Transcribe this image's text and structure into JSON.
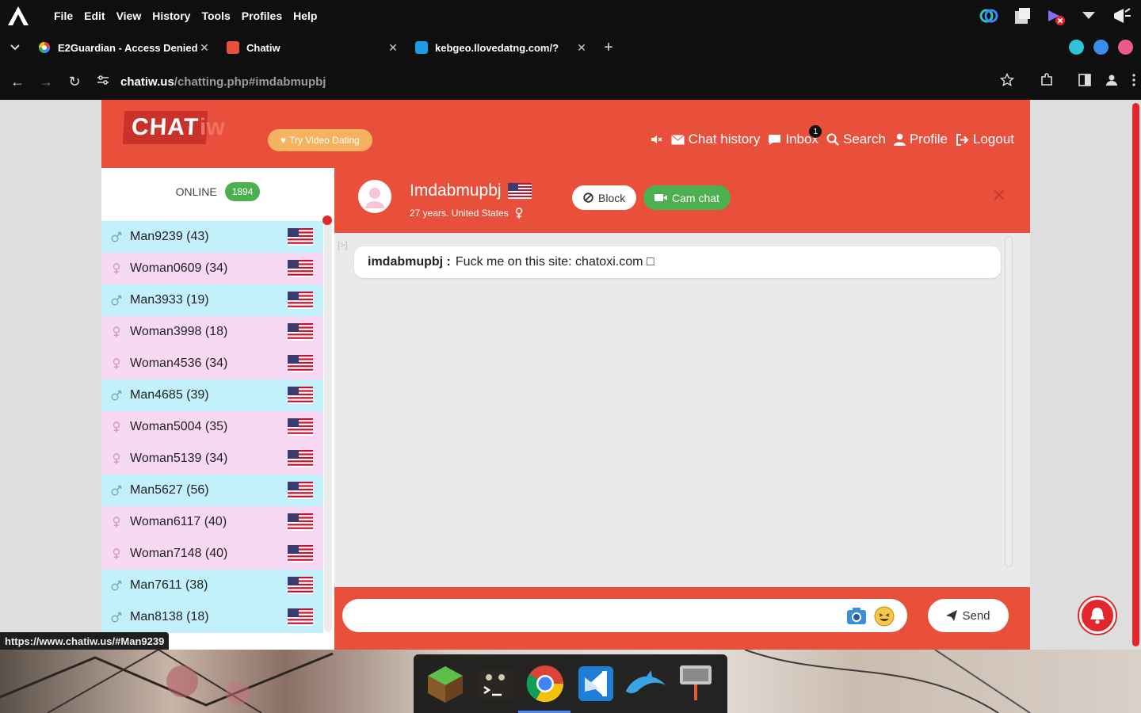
{
  "menubar": {
    "items": [
      "File",
      "Edit",
      "View",
      "History",
      "Tools",
      "Profiles",
      "Help"
    ]
  },
  "tabs": [
    {
      "title": "E2Guardian - Access Denied",
      "favicon": "google-icon"
    },
    {
      "title": "Chatiw",
      "favicon": "chatiw-icon"
    },
    {
      "title": "kebgeo.llovedatng.com/?",
      "favicon": "blue-square-icon"
    }
  ],
  "address": {
    "host": "chatiw.us",
    "path": "/chatting.php#imdabmupbj"
  },
  "site": {
    "brand_chat": "CHAT",
    "brand_iw": "iw",
    "video_button": "Try Video Dating",
    "nav": {
      "chat_history": "Chat history",
      "inbox": "Inbox",
      "inbox_badge": "1",
      "search": "Search",
      "profile": "Profile",
      "logout": "Logout"
    }
  },
  "sidebar": {
    "online_label": "ONLINE",
    "online_count": "1894",
    "users": [
      {
        "name": "Man9239 (43)",
        "gender": "male"
      },
      {
        "name": "Woman0609 (34)",
        "gender": "female"
      },
      {
        "name": "Man3933 (19)",
        "gender": "male"
      },
      {
        "name": "Woman3998 (18)",
        "gender": "female"
      },
      {
        "name": "Woman4536 (34)",
        "gender": "female"
      },
      {
        "name": "Man4685 (39)",
        "gender": "male"
      },
      {
        "name": "Woman5004 (35)",
        "gender": "female"
      },
      {
        "name": "Woman5139 (34)",
        "gender": "female"
      },
      {
        "name": "Man5627 (56)",
        "gender": "male"
      },
      {
        "name": "Woman6117 (40)",
        "gender": "female"
      },
      {
        "name": "Woman7148 (40)",
        "gender": "female"
      },
      {
        "name": "Man7611 (38)",
        "gender": "male"
      },
      {
        "name": "Man8138 (18)",
        "gender": "male"
      }
    ]
  },
  "chat": {
    "partner_name": "Imdabmupbj",
    "partner_info": "27 years. United States",
    "block_label": "Block",
    "cam_label": "Cam chat",
    "close_glyph": "✕",
    "messages": [
      {
        "sender": "imdabmupbj :",
        "text": "Fuck me on this site: chatoxi.com □"
      }
    ],
    "input_placeholder": "",
    "send_label": "Send"
  },
  "status_url": "https://www.chatiw.us/#Man9239",
  "colors": {
    "brand_red": "#e8503b",
    "male_row": "#c3f1fb",
    "female_row": "#f7d9f3",
    "online_green": "#4caf50",
    "video_orange": "#f6b35f"
  }
}
